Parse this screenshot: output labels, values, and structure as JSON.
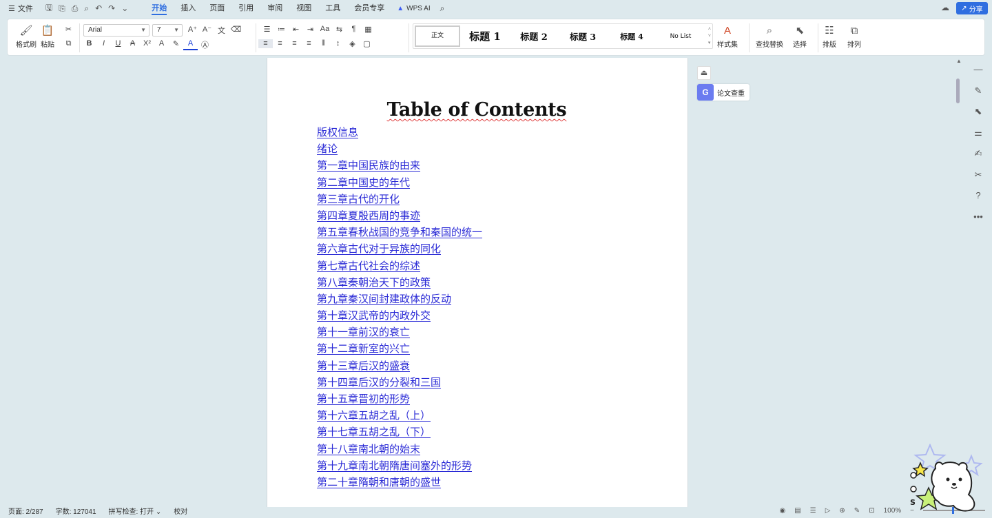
{
  "menubar": {
    "file_label": "文件",
    "tabs": [
      "开始",
      "插入",
      "页面",
      "引用",
      "审阅",
      "视图",
      "工具",
      "会员专享"
    ],
    "active_tab": "开始",
    "wps_ai_label": "WPS AI",
    "share_label": "分享"
  },
  "ribbon": {
    "format_painter": "格式刷",
    "paste": "粘贴",
    "font_name": "Arial",
    "font_size": "7",
    "styles": [
      "正文",
      "标题 1",
      "标题 2",
      "标题 3",
      "标题 4",
      "No List"
    ],
    "style_set": "样式集",
    "find_replace": "查找替换",
    "select": "选择",
    "layout": "排版",
    "arrange": "排列"
  },
  "document": {
    "title": "Table of Contents",
    "toc": [
      "版权信息",
      "绪论",
      "第一章中国民族的由来",
      "第二章中国史的年代",
      "第三章古代的开化",
      "第四章夏殷西周的事迹",
      "第五章春秋战国的竞争和秦国的统一",
      "第六章古代对于异族的同化",
      "第七章古代社会的综述",
      "第八章秦朝治天下的政策",
      "第九章秦汉间封建政体的反动",
      "第十章汉武帝的内政外交",
      "第十一章前汉的衰亡",
      "第十二章新室的兴亡",
      "第十三章后汉的盛衰",
      "第十四章后汉的分裂和三国",
      "第十五章晋初的形势",
      "第十六章五胡之乱（上）",
      "第十七章五胡之乱（下）",
      "第十八章南北朝的始末",
      "第十九章南北朝隋唐间塞外的形势",
      "第二十章隋朝和唐朝的盛世"
    ]
  },
  "side_panel": {
    "essay_check": "论文查重"
  },
  "statusbar": {
    "page": "页面: 2/287",
    "word_count": "字数: 127041",
    "spell_check": "拼写检查: 打开",
    "proofread": "校对",
    "zoom": "100%"
  },
  "colors": {
    "accent": "#2f6ee0",
    "link": "#2a2ad6",
    "background": "#dde9ed"
  }
}
